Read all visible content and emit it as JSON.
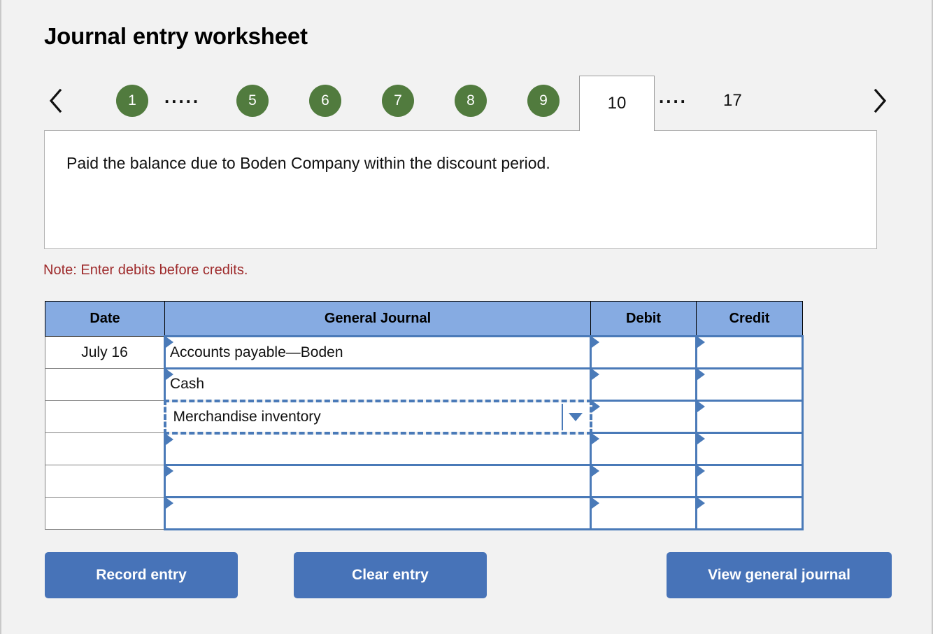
{
  "header": {
    "title": "Journal entry worksheet"
  },
  "pager": {
    "prev_icon": "chevron-left-icon",
    "next_icon": "chevron-right-icon",
    "ellipsis_left": ".....",
    "ellipsis_right": "....",
    "active_page": "10",
    "last_page": "17",
    "pages": [
      "1",
      "5",
      "6",
      "7",
      "8",
      "9"
    ]
  },
  "scenario": {
    "text": "Paid the balance due to Boden Company within the discount period."
  },
  "note": {
    "text": "Note: Enter debits before credits."
  },
  "journal": {
    "columns": [
      "Date",
      "General Journal",
      "Debit",
      "Credit"
    ],
    "rows": [
      {
        "date": "July 16",
        "account": "Accounts payable—Boden",
        "debit": "",
        "credit": "",
        "selected": false
      },
      {
        "date": "",
        "account": "Cash",
        "debit": "",
        "credit": "",
        "selected": false
      },
      {
        "date": "",
        "account": "Merchandise inventory",
        "debit": "",
        "credit": "",
        "selected": true
      },
      {
        "date": "",
        "account": "",
        "debit": "",
        "credit": "",
        "selected": false
      },
      {
        "date": "",
        "account": "",
        "debit": "",
        "credit": "",
        "selected": false
      },
      {
        "date": "",
        "account": "",
        "debit": "",
        "credit": "",
        "selected": false
      }
    ]
  },
  "actions": {
    "record_label": "Record entry",
    "clear_label": "Clear entry",
    "view_label": "View general journal"
  },
  "colors": {
    "page_background": "#f2f2f2",
    "pager_green": "#517b3e",
    "table_header_blue": "#86abe2",
    "cell_border_blue": "#4a7ab8",
    "button_blue": "#4773b8",
    "note_red": "#9e2a2b"
  }
}
